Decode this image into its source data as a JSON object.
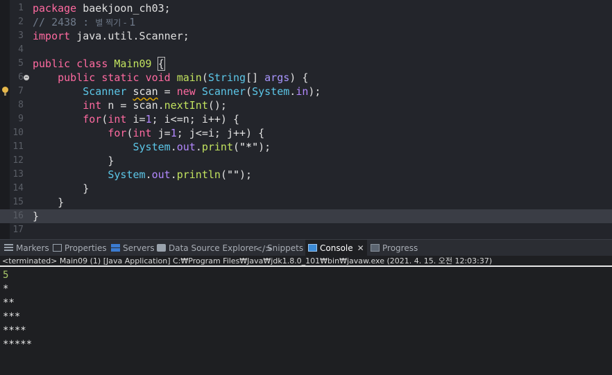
{
  "editor": {
    "line_numbers": [
      "1",
      "2",
      "3",
      "4",
      "5",
      "6",
      "7",
      "8",
      "9",
      "10",
      "11",
      "12",
      "13",
      "14",
      "15",
      "16",
      "17"
    ],
    "l1": {
      "kw": "package",
      "rest": " baekjoon_ch03;"
    },
    "l2": {
      "comment": "// 2438 : ",
      "comment_kr": "별 찍기 - ",
      "comment_num": "1"
    },
    "l3": {
      "kw": "import",
      "rest": " java.util.Scanner;"
    },
    "l5": {
      "kw1": "public",
      "kw2": "class",
      "name": "Main09",
      "brace": "{"
    },
    "l6": {
      "kw1": "public",
      "kw2": "static",
      "kw3": "void",
      "fn": "main",
      "type": "String",
      "brackets": "[] ",
      "param": "args",
      "tail": ") {"
    },
    "l7": {
      "type": "Scanner",
      "var": "scan",
      "eq": " = ",
      "kw": "new",
      "type2": "Scanner",
      "open": "(",
      "cls": "System",
      "dot": ".",
      "field": "in",
      "close": ");"
    },
    "l8": {
      "kw": "int",
      "rest": " n = scan.",
      "fn": "nextInt",
      "tail": "();"
    },
    "l9": {
      "kw": "for",
      "open": "(",
      "kw2": "int",
      "a": " i=",
      "n1": "1",
      "b": "; i<=n; i++) {"
    },
    "l10": {
      "kw": "for",
      "open": "(",
      "kw2": "int",
      "a": " j=",
      "n1": "1",
      "b": "; j<=i; j++) {"
    },
    "l11": {
      "cls": "System",
      "dot": ".",
      "field": "out",
      "dot2": ".",
      "fn": "print",
      "open": "(",
      "str": "\"*\"",
      "close": ");"
    },
    "l12": {
      "text": "}"
    },
    "l13": {
      "cls": "System",
      "dot": ".",
      "field": "out",
      "dot2": ".",
      "fn": "println",
      "open": "(",
      "str": "\"\"",
      "close": ");"
    },
    "l14": {
      "text": "}"
    },
    "l15": {
      "text": "}"
    },
    "l16": {
      "text": "}"
    }
  },
  "tabs": [
    {
      "label": "Markers"
    },
    {
      "label": "Properties"
    },
    {
      "label": "Servers"
    },
    {
      "label": "Data Source Explorer"
    },
    {
      "label": "Snippets",
      "icon_glyph": "</>"
    },
    {
      "label": "Console",
      "close": "✕"
    },
    {
      "label": "Progress"
    }
  ],
  "status_line": "<terminated> Main09 (1) [Java Application] C:₩Program Files₩Java₩jdk1.8.0_101₩bin₩javaw.exe (2021. 4. 15. 오전 12:03:37)",
  "console_output": [
    "5",
    "*",
    "**",
    "***",
    "****",
    "*****"
  ]
}
